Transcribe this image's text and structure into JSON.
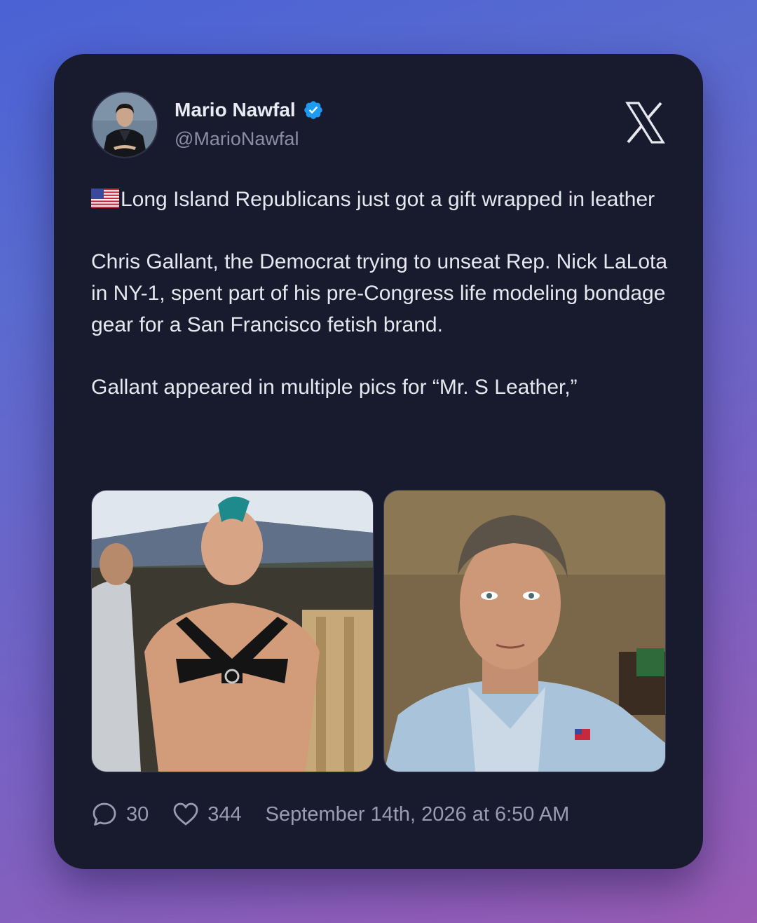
{
  "author": {
    "name": "Mario Nawfal",
    "handle": "@MarioNawfal",
    "verified": true,
    "avatar_icon": "profile-photo"
  },
  "platform_icon": "x-logo-icon",
  "tweet": {
    "flag_icon": "us-flag-emoji",
    "paragraph_1": "Long Island Republicans just got a gift wrapped in leather",
    "paragraph_2": "Chris Gallant, the Democrat trying to unseat Rep. Nick LaLota in NY-1, spent part of his pre-Congress life modeling bondage gear for a San Francisco fetish brand.",
    "paragraph_3": "Gallant appeared in multiple pics for “Mr. S Leather,”"
  },
  "media": [
    {
      "description_icon": "photo-man-leather-harness-outdoors"
    },
    {
      "description_icon": "photo-man-light-blue-suit-selfie"
    }
  ],
  "stats": {
    "replies": "30",
    "likes": "344",
    "timestamp": "September 14th, 2026 at 6:50 AM"
  },
  "colors": {
    "card_bg": "#181a2e",
    "verified_blue": "#1d9bf0",
    "text_primary": "#e6e7ef",
    "text_secondary": "#9a9db2"
  }
}
